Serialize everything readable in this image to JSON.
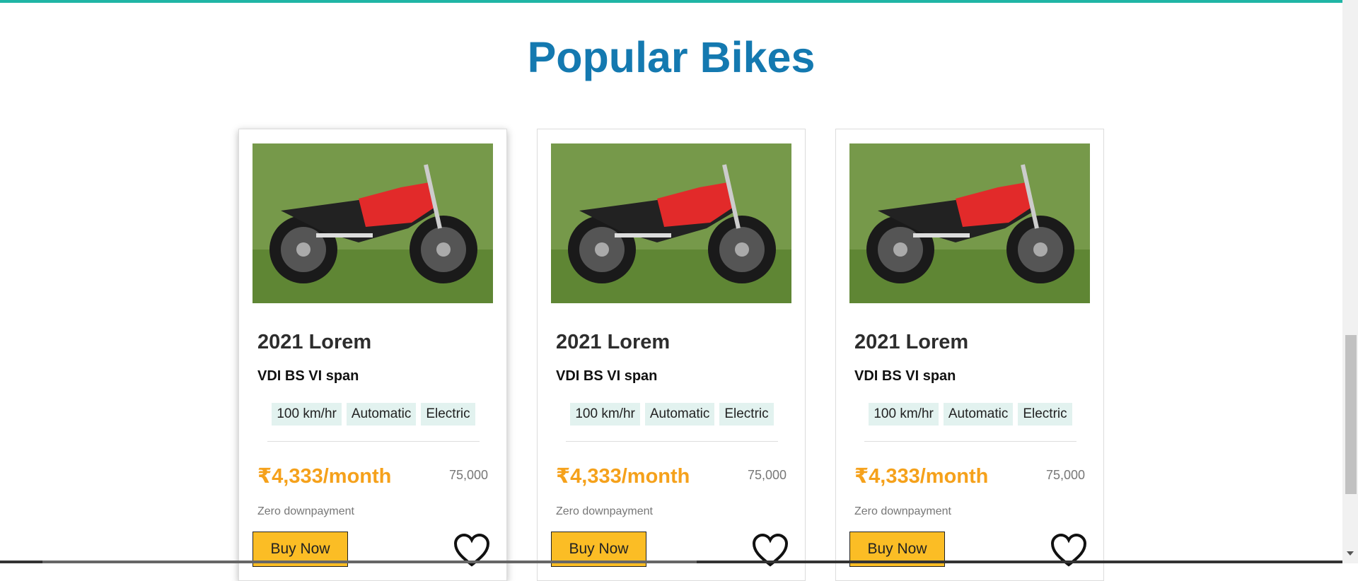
{
  "section": {
    "title": "Popular Bikes"
  },
  "cards": [
    {
      "title": "2021 Lorem",
      "subtitle": "VDI BS VI span",
      "tags": [
        "100 km/hr",
        "Automatic",
        "Electric"
      ],
      "price": "₹4,333/month",
      "mrp": "75,000",
      "downpayment": "Zero downpayment",
      "buy_label": "Buy Now"
    },
    {
      "title": "2021 Lorem",
      "subtitle": "VDI BS VI span",
      "tags": [
        "100 km/hr",
        "Automatic",
        "Electric"
      ],
      "price": "₹4,333/month",
      "mrp": "75,000",
      "downpayment": "Zero downpayment",
      "buy_label": "Buy Now"
    },
    {
      "title": "2021 Lorem",
      "subtitle": "VDI BS VI span",
      "tags": [
        "100 km/hr",
        "Automatic",
        "Electric"
      ],
      "price": "₹4,333/month",
      "mrp": "75,000",
      "downpayment": "Zero downpayment",
      "buy_label": "Buy Now"
    }
  ],
  "colors": {
    "accent_bar": "#1fb5a5",
    "heading": "#1479b0",
    "price": "#f5a11b",
    "button": "#fbbd25",
    "tag_bg": "#e2f2ef"
  },
  "icons": {
    "wishlist": "heart-outline-icon",
    "image": "motorcycle-photo"
  }
}
